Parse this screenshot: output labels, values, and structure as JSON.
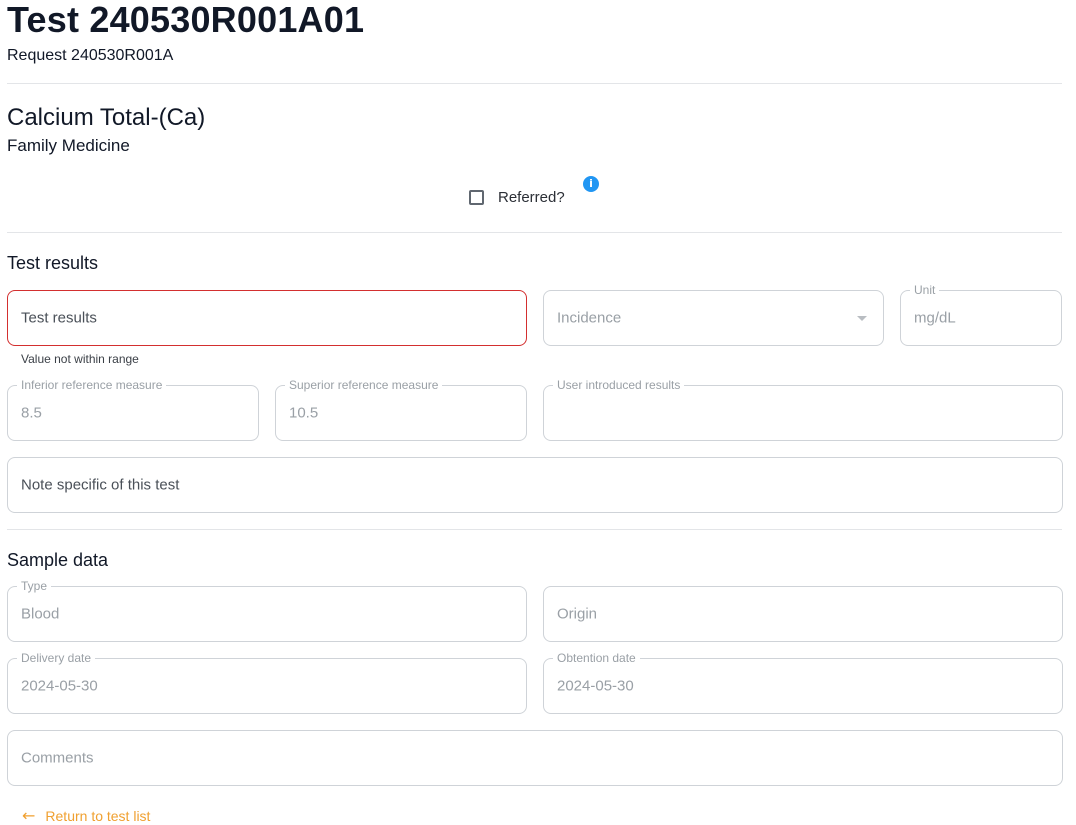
{
  "header": {
    "title": "Test 240530R001A01",
    "request": "Request 240530R001A"
  },
  "test": {
    "name": "Calcium Total-(Ca)",
    "department": "Family Medicine"
  },
  "referred": {
    "label": "Referred?",
    "checked": false,
    "info_icon": "info-icon"
  },
  "results": {
    "heading": "Test results",
    "test_results_placeholder": "Test results",
    "error_text": "Value not within range",
    "incidence_placeholder": "Incidence",
    "unit_label": "Unit",
    "unit_value": "mg/dL",
    "inferior_label": "Inferior reference measure",
    "inferior_value": "8.5",
    "superior_label": "Superior reference measure",
    "superior_value": "10.5",
    "user_results_label": "User introduced results",
    "user_results_value": "",
    "note_placeholder": "Note specific of this test"
  },
  "sample": {
    "heading": "Sample data",
    "type_label": "Type",
    "type_value": "Blood",
    "origin_placeholder": "Origin",
    "delivery_label": "Delivery date",
    "delivery_value": "2024-05-30",
    "obtention_label": "Obtention date",
    "obtention_value": "2024-05-30",
    "comments_placeholder": "Comments"
  },
  "footer": {
    "back_label": "Return to test list",
    "back_icon": "arrow-left-icon",
    "accent": "#f0a030"
  },
  "colors": {
    "error": "#d32f2f",
    "info": "#2196f3"
  }
}
